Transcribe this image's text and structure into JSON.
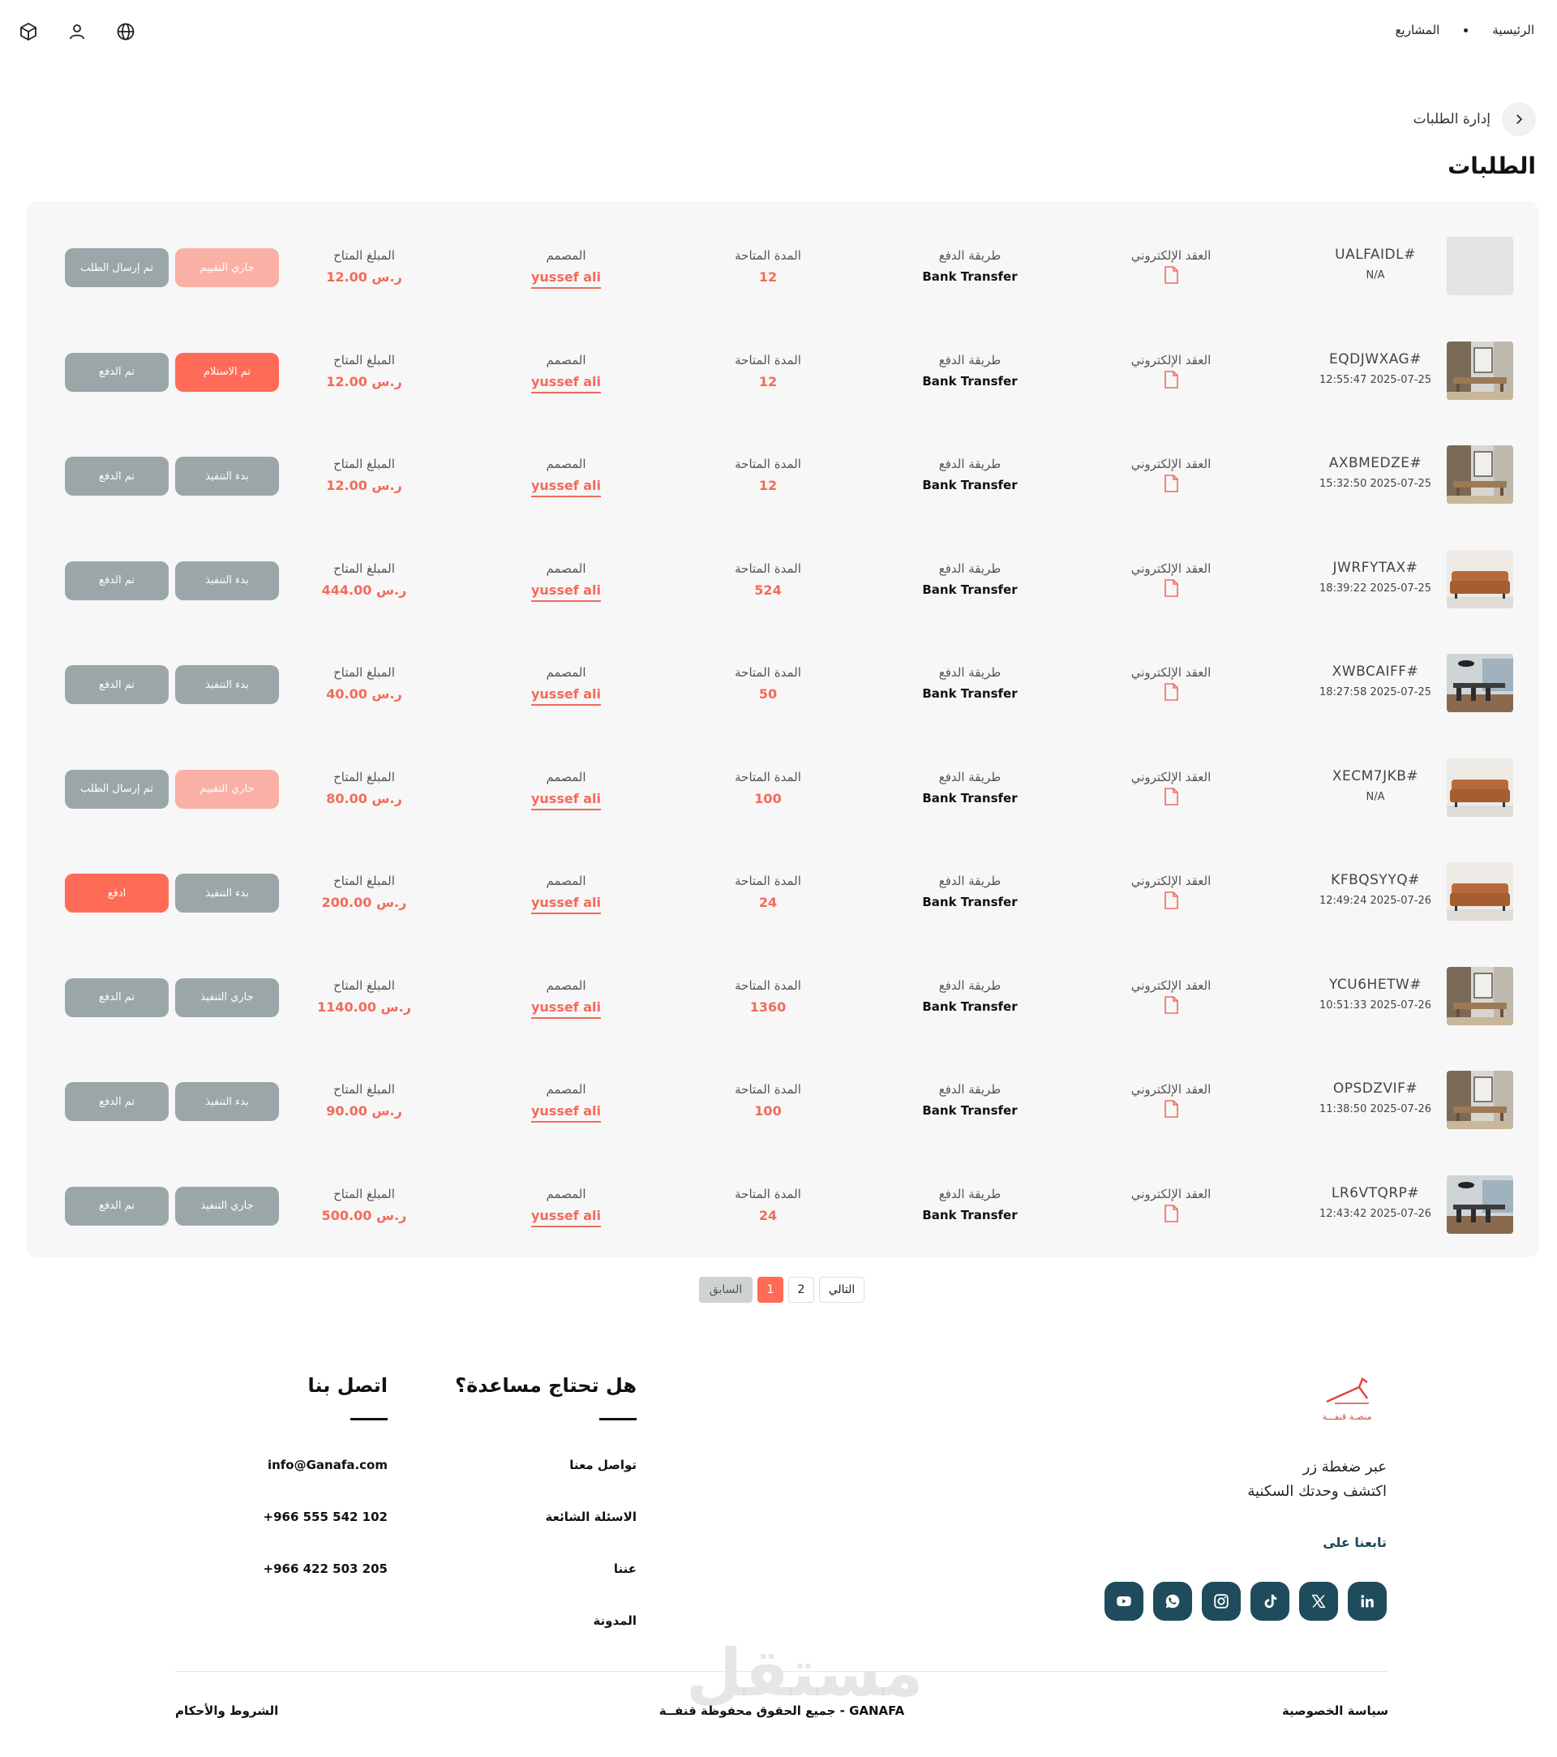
{
  "nav": {
    "home": "الرئيسية",
    "projects": "المشاريع"
  },
  "breadcrumb": {
    "label": "إدارة الطلبات"
  },
  "page_title": "الطلبات",
  "labels": {
    "contract": "العقد الإلكتروني",
    "payment_method": "طريقة الدفع",
    "area": "المدة المتاحة",
    "designer": "المصمم",
    "amount": "المبلغ المتاح",
    "currency": "ر.س"
  },
  "orders": [
    {
      "id": "UALFAIDL#",
      "date": "N/A",
      "thumb": "blank",
      "payment": "Bank Transfer",
      "area": "12",
      "designer": "yussef ali",
      "amount": "12.00",
      "buttons": [
        {
          "label": "تم إرسال الطلب",
          "style": "gray"
        },
        {
          "label": "جاري التقييم",
          "style": "pink"
        }
      ]
    },
    {
      "id": "EQDJWXAG#",
      "date": "12:55:47 2025-07-25",
      "thumb": "room",
      "payment": "Bank Transfer",
      "area": "12",
      "designer": "yussef ali",
      "amount": "12.00",
      "buttons": [
        {
          "label": "تم الدفع",
          "style": "gray"
        },
        {
          "label": "تم الاستلام",
          "style": "red"
        }
      ]
    },
    {
      "id": "AXBMEDZE#",
      "date": "15:32:50 2025-07-25",
      "thumb": "room",
      "payment": "Bank Transfer",
      "area": "12",
      "designer": "yussef ali",
      "amount": "12.00",
      "buttons": [
        {
          "label": "تم الدفع",
          "style": "gray"
        },
        {
          "label": "بدء التنفيذ",
          "style": "gray"
        }
      ]
    },
    {
      "id": "JWRFYTAX#",
      "date": "18:39:22 2025-07-25",
      "thumb": "sofa",
      "payment": "Bank Transfer",
      "area": "524",
      "designer": "yussef ali",
      "amount": "444.00",
      "buttons": [
        {
          "label": "تم الدفع",
          "style": "gray"
        },
        {
          "label": "بدء التنفيذ",
          "style": "gray"
        }
      ]
    },
    {
      "id": "XWBCAIFF#",
      "date": "18:27:58 2025-07-25",
      "thumb": "dining",
      "payment": "Bank Transfer",
      "area": "50",
      "designer": "yussef ali",
      "amount": "40.00",
      "buttons": [
        {
          "label": "تم الدفع",
          "style": "gray"
        },
        {
          "label": "بدء التنفيذ",
          "style": "gray"
        }
      ]
    },
    {
      "id": "XECM7JKB#",
      "date": "N/A",
      "thumb": "sofa",
      "payment": "Bank Transfer",
      "area": "100",
      "designer": "yussef ali",
      "amount": "80.00",
      "buttons": [
        {
          "label": "تم إرسال الطلب",
          "style": "gray"
        },
        {
          "label": "جاري التقييم",
          "style": "pink"
        }
      ]
    },
    {
      "id": "KFBQSYYQ#",
      "date": "12:49:24 2025-07-26",
      "thumb": "sofa",
      "payment": "Bank Transfer",
      "area": "24",
      "designer": "yussef ali",
      "amount": "200.00",
      "buttons": [
        {
          "label": "ادفع",
          "style": "red"
        },
        {
          "label": "بدء التنفيذ",
          "style": "gray"
        }
      ]
    },
    {
      "id": "YCU6HETW#",
      "date": "10:51:33 2025-07-26",
      "thumb": "room",
      "payment": "Bank Transfer",
      "area": "1360",
      "designer": "yussef ali",
      "amount": "1140.00",
      "buttons": [
        {
          "label": "تم الدفع",
          "style": "gray"
        },
        {
          "label": "جاري التنفيذ",
          "style": "gray"
        }
      ]
    },
    {
      "id": "OPSDZVIF#",
      "date": "11:38:50 2025-07-26",
      "thumb": "room",
      "payment": "Bank Transfer",
      "area": "100",
      "designer": "yussef ali",
      "amount": "90.00",
      "buttons": [
        {
          "label": "تم الدفع",
          "style": "gray"
        },
        {
          "label": "بدء التنفيذ",
          "style": "gray"
        }
      ]
    },
    {
      "id": "LR6VTQRP#",
      "date": "12:43:42 2025-07-26",
      "thumb": "dining",
      "payment": "Bank Transfer",
      "area": "24",
      "designer": "yussef ali",
      "amount": "500.00",
      "buttons": [
        {
          "label": "تم الدفع",
          "style": "gray"
        },
        {
          "label": "جاري التنفيذ",
          "style": "gray"
        }
      ]
    }
  ],
  "pagination": {
    "prev": "السابق",
    "pages": [
      "1",
      "2"
    ],
    "current": "1",
    "next": "التالي"
  },
  "footer": {
    "logo_text": "منصـة قنفـــة",
    "tagline_1": "عبر ضغطة زر",
    "tagline_2": "اكتشف وحدتك السكنية",
    "follow": "تابعنا على",
    "socials": [
      "linkedin-icon",
      "x-icon",
      "tiktok-icon",
      "instagram-icon",
      "whatsapp-icon",
      "youtube-icon"
    ],
    "help": {
      "title": "هل تحتاج مساعدة؟",
      "links": [
        "تواصل معنا",
        "الاسئلة الشائعة",
        "عننا",
        "المدونة"
      ]
    },
    "contact": {
      "title": "اتصل بنا",
      "items": [
        "info@Ganafa.com",
        "+966 555 542 102",
        "+966 422 503 205"
      ]
    },
    "privacy": "سياسة الخصوصية",
    "rights": "جميع الحقوق محفوظة قنفــة - GANAFA",
    "terms": "الشروط والأحكام",
    "watermark": "مستقل"
  },
  "colors": {
    "accent": "#ff6b57",
    "gray_button": "#9aa6a8",
    "pink_button": "#fbb0a6",
    "social_bg": "#1f4c5c"
  }
}
